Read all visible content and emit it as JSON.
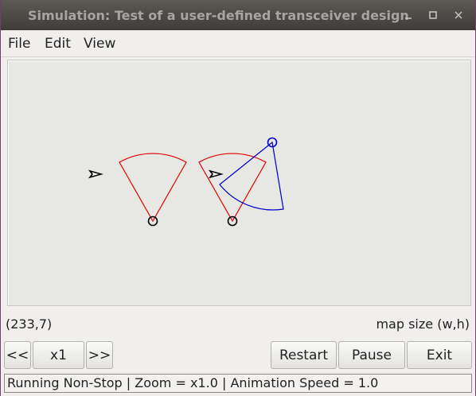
{
  "window": {
    "title": "Simulation: Test of a user-defined transceiver design"
  },
  "menu": {
    "items": [
      {
        "label": "File"
      },
      {
        "label": "Edit"
      },
      {
        "label": "View"
      }
    ]
  },
  "canvas": {
    "nodes": [
      {
        "name": "transmitter-1",
        "kind": "arrow",
        "color": "#000000"
      },
      {
        "name": "receiver-1",
        "kind": "circle-with-sector",
        "color": "#000000",
        "sector_color": "#e00000"
      },
      {
        "name": "transmitter-2",
        "kind": "arrow",
        "color": "#000000"
      },
      {
        "name": "receiver-2",
        "kind": "circle-with-sector",
        "color": "#000000",
        "sector_color": "#e00000"
      },
      {
        "name": "transceiver-3",
        "kind": "circle-with-sector",
        "color": "#0000c8",
        "sector_color": "#0000c8"
      }
    ]
  },
  "info": {
    "coords": "(233,7)",
    "map_size": "map size (w,h)"
  },
  "controls": {
    "prev": "<<",
    "speed": "x1",
    "next": ">>",
    "restart": "Restart",
    "pause": "Pause",
    "exit": "Exit"
  },
  "status": {
    "text": "Running Non-Stop | Zoom = x1.0 | Animation Speed = 1.0"
  }
}
